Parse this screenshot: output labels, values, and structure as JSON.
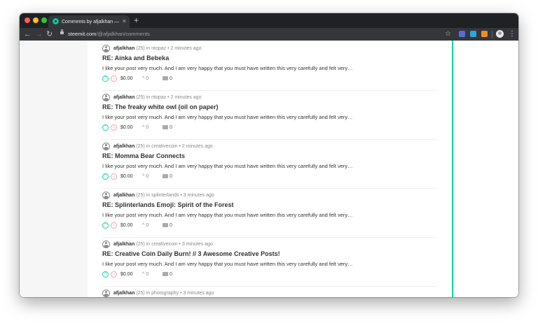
{
  "browser": {
    "tab_title": "Comments by afjalkhan — Steemit",
    "tab_close": "×",
    "new_tab": "+",
    "url_domain": "steemit.com",
    "url_path": "/@afjalkhan/comments",
    "back": "←",
    "forward": "→",
    "reload": "↻",
    "star": "☆",
    "menu": "⋮"
  },
  "colors": {
    "accent": "#06d6a9",
    "downvote": "#f5a0a0"
  },
  "comments": [
    {
      "author": "afjalkhan",
      "reputation": "(25)",
      "community": "in ntopaz",
      "time": "• 2 minutes ago",
      "title": "RE: Ainka and Bebeka",
      "excerpt": "I like your post very much. And I am very happy that you must have written this very carefully and felt very…",
      "payout": "$0.00",
      "votes": "0",
      "replies": "0"
    },
    {
      "author": "afjalkhan",
      "reputation": "(25)",
      "community": "in ntopaz",
      "time": "• 2 minutes ago",
      "title": "RE: The freaky white owl (oil on paper)",
      "excerpt": "I like your post very much. And I am very happy that you must have written this very carefully and felt very…",
      "payout": "$0.00",
      "votes": "0",
      "replies": "0"
    },
    {
      "author": "afjalkhan",
      "reputation": "(25)",
      "community": "in creativecoin",
      "time": "• 2 minutes ago",
      "title": "RE: Momma Bear Connects",
      "excerpt": "I like your post very much. And I am very happy that you must have written this very carefully and felt very…",
      "payout": "$0.00",
      "votes": "0",
      "replies": "0"
    },
    {
      "author": "afjalkhan",
      "reputation": "(25)",
      "community": "in splinterlands",
      "time": "• 3 minutes ago",
      "title": "RE: Splinterlands Emoji: Spirit of the Forest",
      "excerpt": "I like your post very much. And I am very happy that you must have written this very carefully and felt very…",
      "payout": "$0.00",
      "votes": "0",
      "replies": "0"
    },
    {
      "author": "afjalkhan",
      "reputation": "(25)",
      "community": "in creativecoin",
      "time": "• 3 minutes ago",
      "title": "RE: Creative Coin Daily Burn! // 3 Awesome Creative Posts!",
      "excerpt": "I like your post very much. And I am very happy that you must have written this very carefully and felt very…",
      "payout": "$0.00",
      "votes": "0",
      "replies": "0"
    },
    {
      "author": "afjalkhan",
      "reputation": "(25)",
      "community": "in photography",
      "time": "• 3 minutes ago"
    }
  ]
}
